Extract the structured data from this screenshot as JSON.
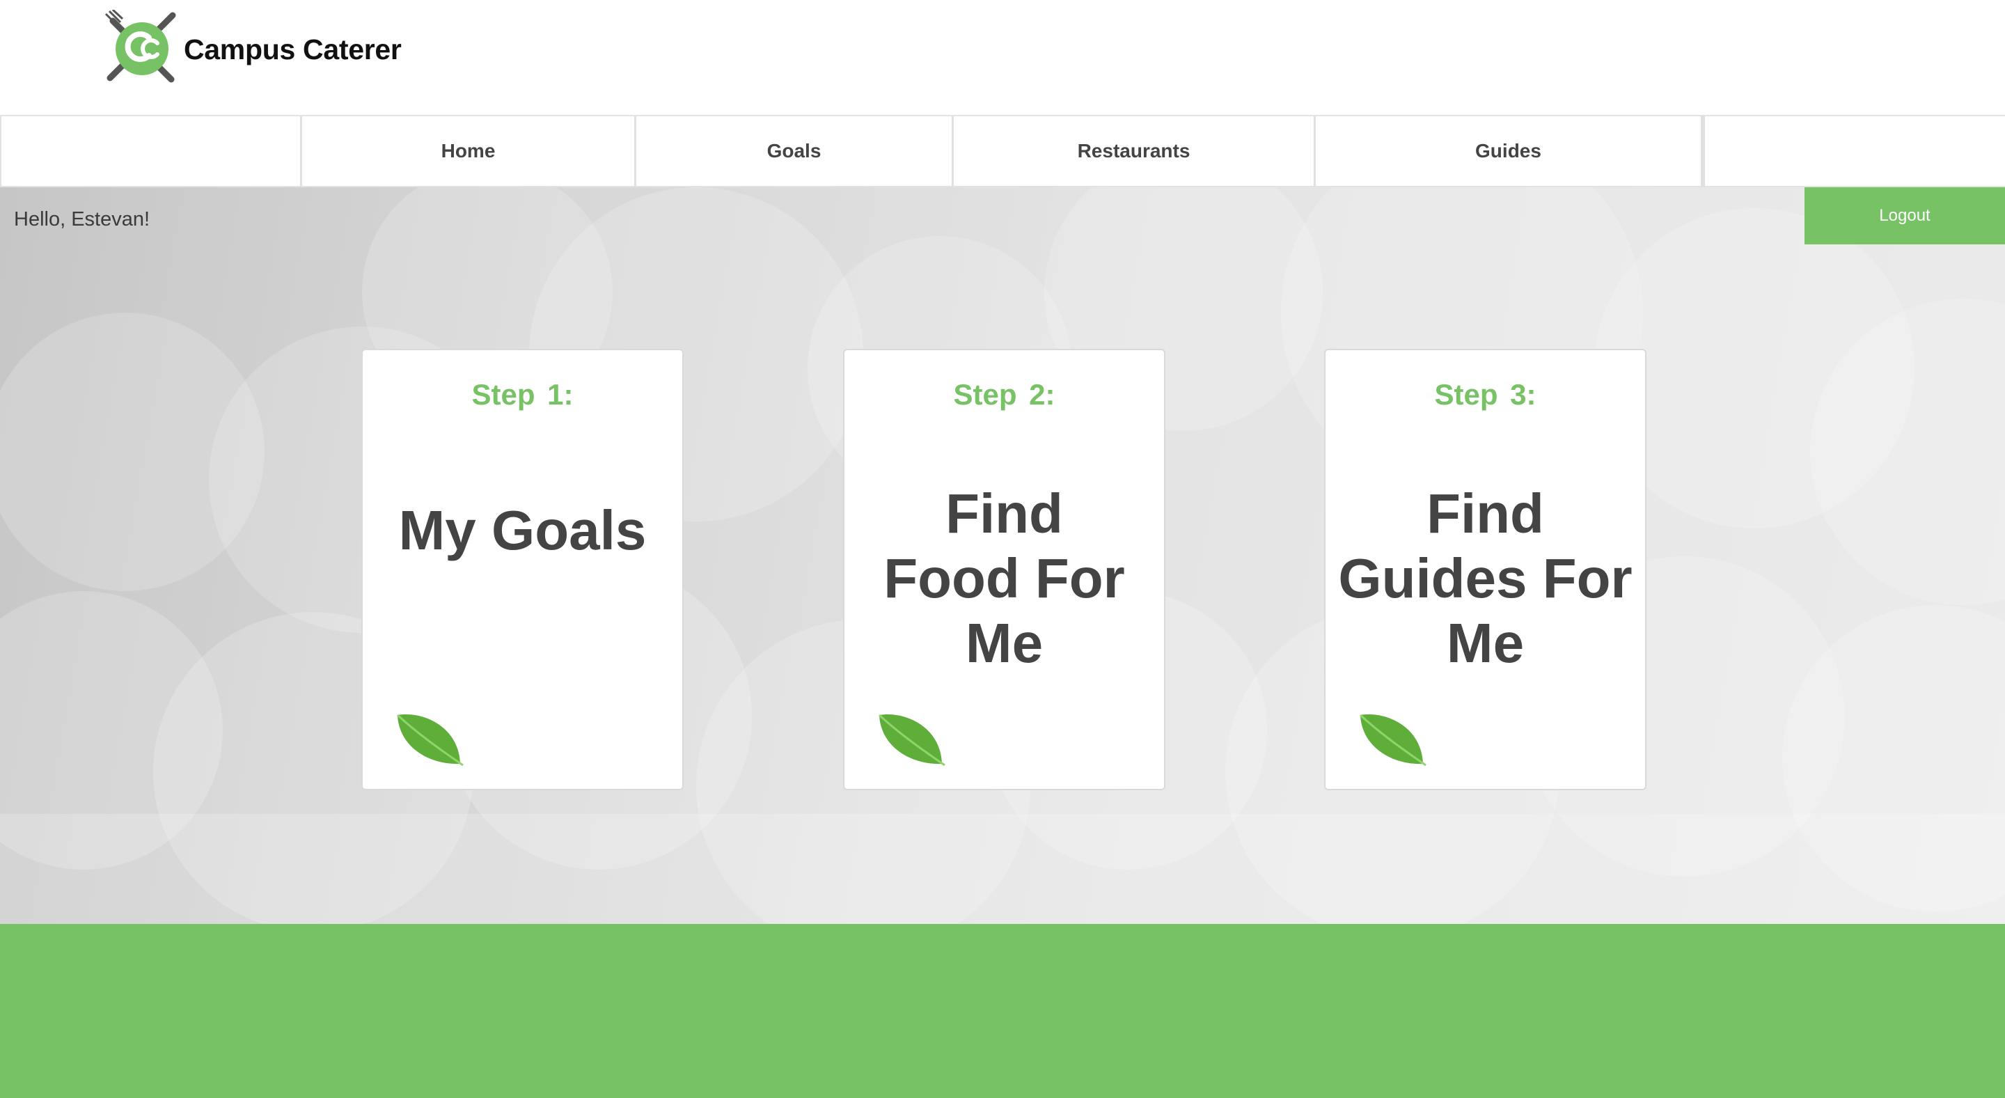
{
  "app": {
    "brand_name": "Campus Caterer",
    "logo_icon": "fork-knife-cc-logo-icon",
    "accent_color": "#77c265",
    "text_color": "#444444"
  },
  "nav": {
    "items": [
      {
        "label": ""
      },
      {
        "label": "Home"
      },
      {
        "label": "Goals"
      },
      {
        "label": "Restaurants"
      },
      {
        "label": "Guides"
      },
      {
        "label": ""
      }
    ]
  },
  "user": {
    "greeting": "Hello, Estevan!",
    "logout_label": "Logout"
  },
  "cards": [
    {
      "step": "Step 1:",
      "title": "My Goals",
      "icon": "leaf-icon"
    },
    {
      "step": "Step 2:",
      "title": "Find Food For Me",
      "icon": "leaf-icon"
    },
    {
      "step": "Step 3:",
      "title": "Find Guides For Me",
      "icon": "leaf-icon"
    }
  ]
}
